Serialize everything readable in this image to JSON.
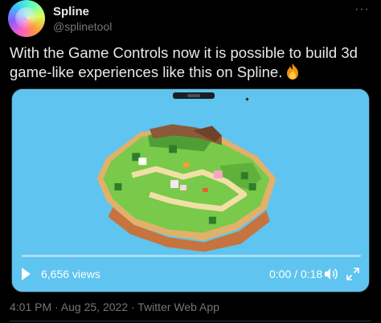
{
  "author": {
    "name": "Spline",
    "handle": "@splinetool"
  },
  "more_label": "···",
  "tweet": {
    "text": "With the Game Controls now it is possible to build 3d game-like experiences like this on Spline."
  },
  "video": {
    "views": "6,656 views",
    "time": "0:00 / 0:18",
    "progress": 0.0,
    "play_icon": "play-icon",
    "volume_icon": "volume-icon",
    "expand_icon": "expand-icon"
  },
  "meta": {
    "timestamp": "4:01 PM · Aug 25, 2022 · Twitter Web App"
  },
  "colors": {
    "background": "#000000",
    "text": "#e7e9ea",
    "muted": "#71767b",
    "sky": "#5fc4ef"
  }
}
